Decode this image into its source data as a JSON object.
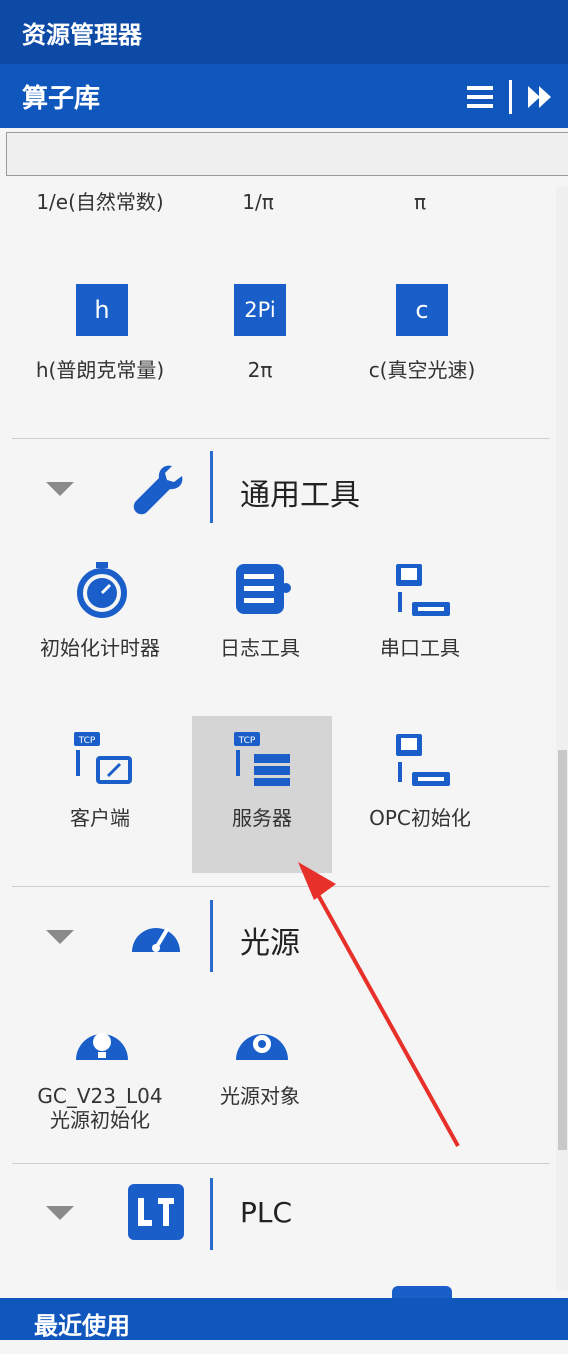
{
  "window": {
    "title": "资源管理器"
  },
  "library": {
    "title": "算子库"
  },
  "search": {
    "value": ""
  },
  "constants": {
    "items": [
      {
        "label": "1/e(自然常数)"
      },
      {
        "label": "1/π"
      },
      {
        "label": "π"
      },
      {
        "label": "h(普朗克常量)",
        "tile": "h"
      },
      {
        "label": "2π",
        "tile": "2Pi"
      },
      {
        "label": "c(真空光速)",
        "tile": "c"
      }
    ]
  },
  "sections": {
    "general": {
      "title": "通用工具",
      "items": [
        {
          "label": "初始化计时器"
        },
        {
          "label": "日志工具"
        },
        {
          "label": "串口工具"
        },
        {
          "label": "客户端"
        },
        {
          "label": "服务器"
        },
        {
          "label": "OPC初始化"
        }
      ]
    },
    "light": {
      "title": "光源",
      "items": [
        {
          "label": "GC_V23_L04光源初始化"
        },
        {
          "label": "光源对象"
        }
      ]
    },
    "plc": {
      "title": "PLC"
    }
  },
  "recent": {
    "title": "最近使用"
  },
  "colors": {
    "header": "#0d4aa6",
    "accent": "#1a5fc9",
    "selected": "#d5d5d5",
    "arrow": "#e8302a"
  }
}
